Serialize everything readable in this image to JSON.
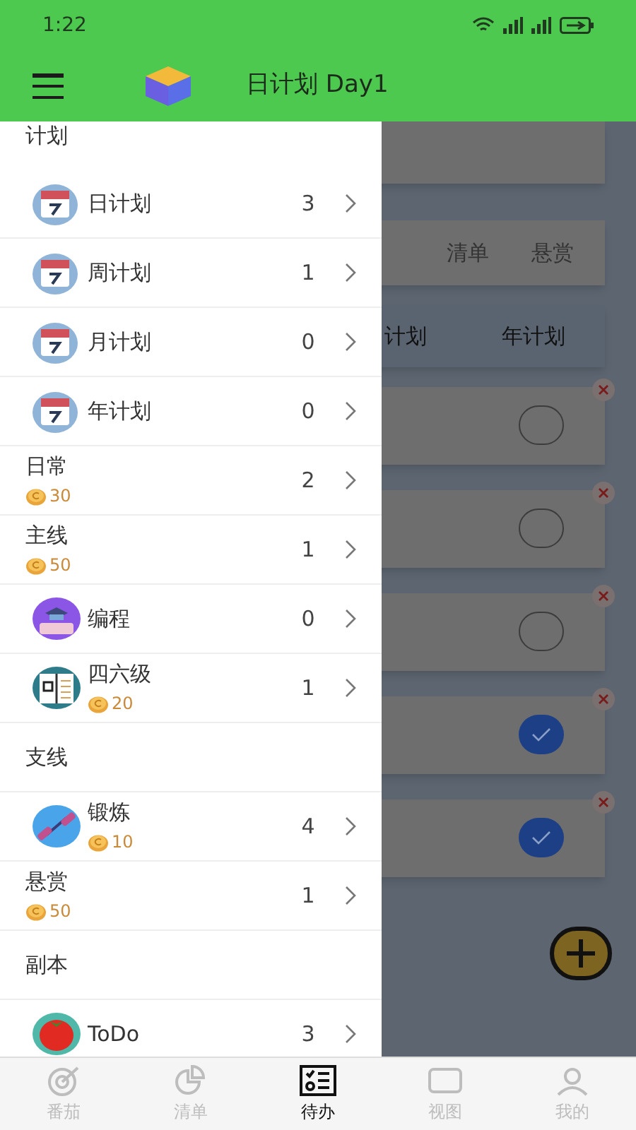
{
  "status_bar": {
    "time": "1:22"
  },
  "app_bar": {
    "title": "日计划 Day1"
  },
  "background": {
    "tabs": [
      {
        "label": "清单"
      },
      {
        "label": "悬赏"
      }
    ],
    "plan_tabs": [
      {
        "label": "计划"
      },
      {
        "label": "年计划"
      }
    ],
    "tasks": [
      {
        "checked": false
      },
      {
        "checked": false
      },
      {
        "checked": false
      },
      {
        "checked": true
      },
      {
        "checked": true
      }
    ]
  },
  "drawer": [
    {
      "kind": "header",
      "label": "计划"
    },
    {
      "kind": "calendar",
      "label": "日计划",
      "count": "3"
    },
    {
      "kind": "calendar",
      "label": "周计划",
      "count": "1"
    },
    {
      "kind": "calendar",
      "label": "月计划",
      "count": "0"
    },
    {
      "kind": "calendar",
      "label": "年计划",
      "count": "0"
    },
    {
      "kind": "plain",
      "label": "日常",
      "coins": "30",
      "count": "2"
    },
    {
      "kind": "plain",
      "label": "主线",
      "coins": "50",
      "count": "1"
    },
    {
      "kind": "coding",
      "label": "编程",
      "count": "0"
    },
    {
      "kind": "book",
      "label": "四六级",
      "coins": "20",
      "count": "1"
    },
    {
      "kind": "header",
      "label": "支线"
    },
    {
      "kind": "dumbbell",
      "label": "锻炼",
      "coins": "10",
      "count": "4"
    },
    {
      "kind": "plain",
      "label": "悬赏",
      "coins": "50",
      "count": "1"
    },
    {
      "kind": "header",
      "label": "副本"
    },
    {
      "kind": "tomato",
      "label": "ToDo",
      "count": "3"
    }
  ],
  "bottom_nav": [
    {
      "label": "番茄",
      "selected": false
    },
    {
      "label": "清单",
      "selected": false
    },
    {
      "label": "待办",
      "selected": true
    },
    {
      "label": "视图",
      "selected": false
    },
    {
      "label": "我的",
      "selected": false
    }
  ]
}
